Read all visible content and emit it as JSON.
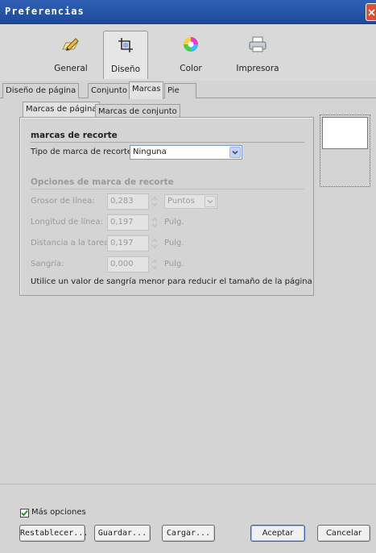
{
  "window": {
    "title": "Preferencias"
  },
  "toolbar": {
    "items": [
      {
        "label": "General",
        "icon": "pencil-icon"
      },
      {
        "label": "Diseño",
        "icon": "crop-icon"
      },
      {
        "label": "Color",
        "icon": "color-wheel-icon"
      },
      {
        "label": "Impresora",
        "icon": "printer-icon"
      }
    ],
    "selected": "Diseño"
  },
  "tabs": {
    "items": [
      "Diseño de página",
      "Conjunto",
      "Marcas",
      "Pie"
    ],
    "selected": "Marcas"
  },
  "subtabs": {
    "items": [
      "Marcas de página",
      "Marcas de conjunto"
    ],
    "selected": "Marcas de página"
  },
  "crop_marks": {
    "section_title": "marcas de recorte",
    "type_label": "Tipo de marca de recorte:",
    "type_value": "Ninguna"
  },
  "crop_options": {
    "section_title": "Opciones de marca de recorte",
    "line_weight": {
      "label": "Grosor de línea:",
      "value": "0,283",
      "unit_value": "Puntos"
    },
    "line_length": {
      "label": "Longitud de línea:",
      "value": "0,197",
      "unit": "Pulg."
    },
    "distance": {
      "label": "Distancia a la tarea:",
      "value": "0,197",
      "unit": "Pulg."
    },
    "bleed": {
      "label": "Sangría:",
      "value": "0,000",
      "unit": "Pulg."
    },
    "hint": "Utilice un valor de sangría menor para reducir el tamaño de la página"
  },
  "footer": {
    "more_options_label": "Más opciones",
    "more_options_checked": true,
    "buttons": {
      "reset": "Restablecer...",
      "save": "Guardar...",
      "load": "Cargar...",
      "ok": "Aceptar",
      "cancel": "Cancelar"
    }
  }
}
